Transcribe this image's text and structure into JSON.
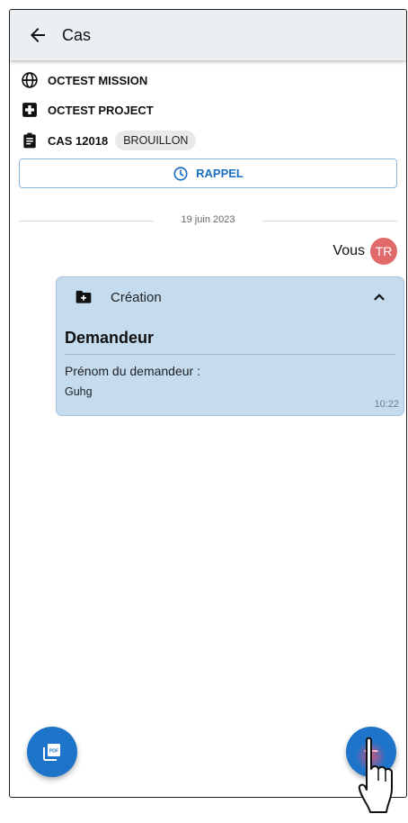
{
  "appbar": {
    "title": "Cas"
  },
  "info": {
    "mission": "OCTEST MISSION",
    "project": "OCTEST PROJECT",
    "case": "CAS 12018",
    "status": "BROUILLON"
  },
  "rappel_label": "RAPPEL",
  "date_separator": "19 juin 2023",
  "message": {
    "sender": "Vous",
    "initials": "TR",
    "header_label": "Création",
    "section": "Demandeur",
    "field_label": "Prénom du demandeur :",
    "field_value": "Guhg",
    "time": "10:22"
  },
  "colors": {
    "primary": "#1e74c8",
    "card": "#c5dcef",
    "avatar": "#e06a6a",
    "appbar": "#eceff2"
  },
  "icons": [
    "back-arrow-icon",
    "globe-icon",
    "medical-cross-icon",
    "clipboard-icon",
    "clock-icon",
    "folder-plus-icon",
    "chevron-up-icon",
    "pdf-icon",
    "plus-icon",
    "hand-pointer-icon"
  ]
}
